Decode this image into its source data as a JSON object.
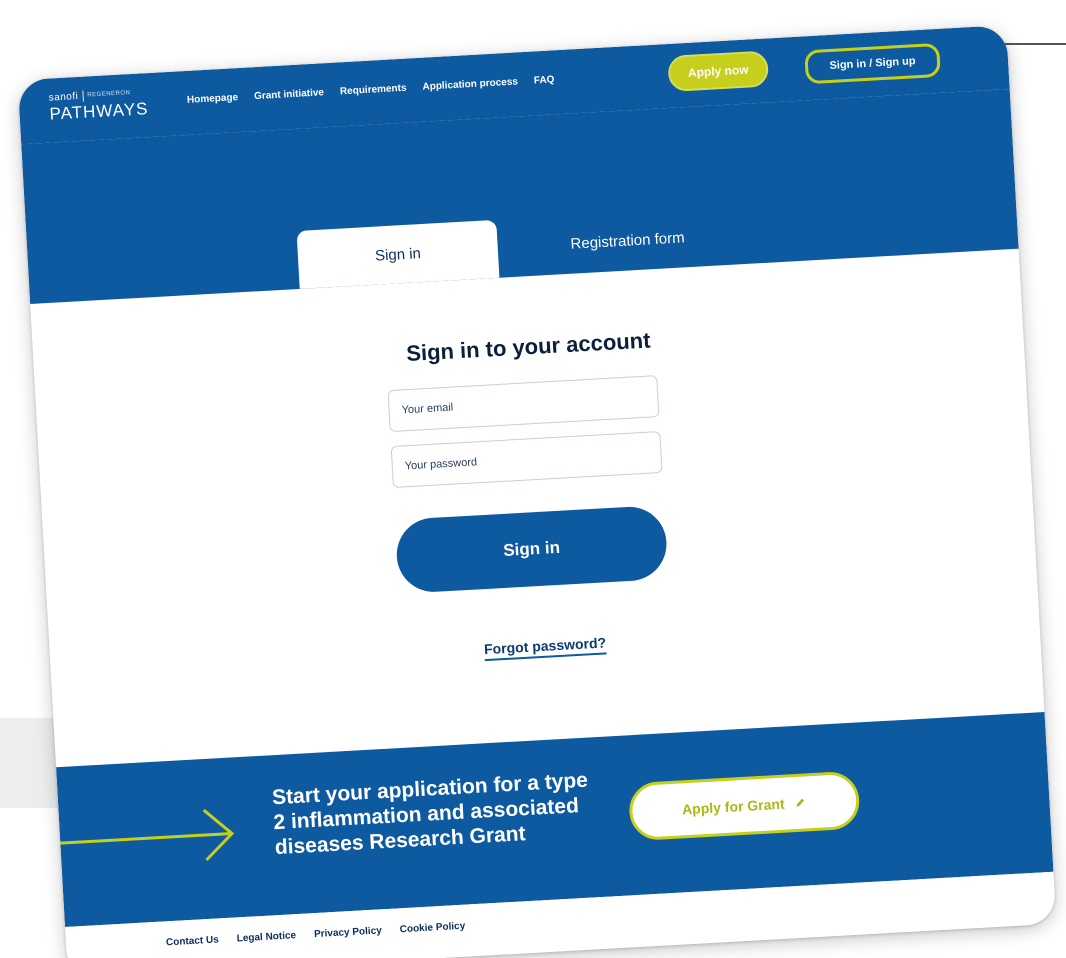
{
  "brand": {
    "company": "sanofi",
    "partner": "REGENERON",
    "product": "PATHWAYS"
  },
  "nav": {
    "items": [
      "Homepage",
      "Grant initiative",
      "Requirements",
      "Application process",
      "FAQ"
    ],
    "apply_now": "Apply now",
    "sign_in_up": "Sign in / Sign up"
  },
  "tabs": {
    "sign_in": "Sign in",
    "registration": "Registration form"
  },
  "form": {
    "title": "Sign in to your account",
    "email_placeholder": "Your email",
    "password_placeholder": "Your password",
    "submit": "Sign in",
    "forgot": "Forgot password?"
  },
  "cta": {
    "text": "Start your application for a type 2 inflammation and associated diseases Research Grant",
    "button": "Apply for Grant"
  },
  "footer": {
    "links": [
      "Contact Us",
      "Legal Notice",
      "Privacy Policy",
      "Cookie Policy"
    ]
  },
  "colors": {
    "primary_blue": "#0d5aa1",
    "accent_lime": "#c5cf1c",
    "dark_text": "#0b1f3a"
  }
}
